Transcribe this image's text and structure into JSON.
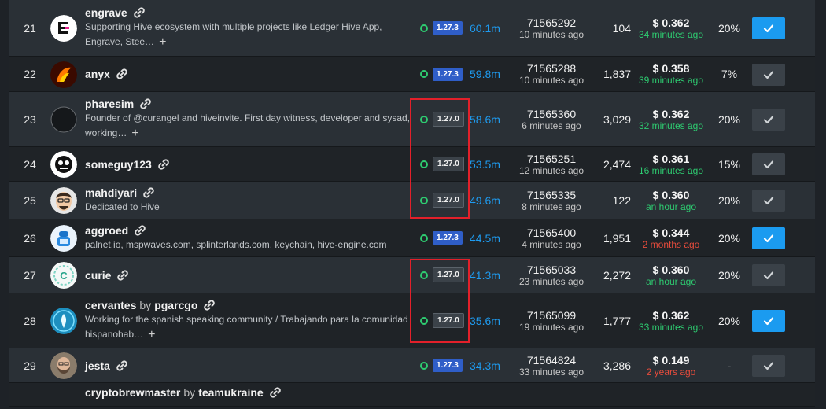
{
  "rows": [
    {
      "rank": "21",
      "name": "engrave",
      "by": "",
      "proxy": "",
      "desc": "Supporting Hive ecosystem with multiple projects like Ledger Hive App, Engrave, Stee…",
      "more": true,
      "version": "1.27.3",
      "vstatus": "new",
      "votes": "60.1m",
      "block": "71565292",
      "block_time": "10 minutes ago",
      "missed": "104",
      "price": "$ 0.362",
      "price_time": "34 minutes ago",
      "price_status": "green",
      "apr": "20%",
      "voted": true,
      "avatar": "engrave"
    },
    {
      "rank": "22",
      "name": "anyx",
      "by": "",
      "proxy": "",
      "desc": "",
      "more": false,
      "version": "1.27.3",
      "vstatus": "new",
      "votes": "59.8m",
      "block": "71565288",
      "block_time": "10 minutes ago",
      "missed": "1,837",
      "price": "$ 0.358",
      "price_time": "39 minutes ago",
      "price_status": "green",
      "apr": "7%",
      "voted": false,
      "avatar": "anyx"
    },
    {
      "rank": "23",
      "name": "pharesim",
      "by": "",
      "proxy": "",
      "desc": "Founder of @curangel and hiveinvite. First day witness, developer and sysad, working…",
      "more": true,
      "version": "1.27.0",
      "vstatus": "old",
      "votes": "58.6m",
      "block": "71565360",
      "block_time": "6 minutes ago",
      "missed": "3,029",
      "price": "$ 0.362",
      "price_time": "32 minutes ago",
      "price_status": "green",
      "apr": "20%",
      "voted": false,
      "avatar": "pharesim"
    },
    {
      "rank": "24",
      "name": "someguy123",
      "by": "",
      "proxy": "",
      "desc": "",
      "more": false,
      "version": "1.27.0",
      "vstatus": "old",
      "votes": "53.5m",
      "block": "71565251",
      "block_time": "12 minutes ago",
      "missed": "2,474",
      "price": "$ 0.361",
      "price_time": "16 minutes ago",
      "price_status": "green",
      "apr": "15%",
      "voted": false,
      "avatar": "someguy"
    },
    {
      "rank": "25",
      "name": "mahdiyari",
      "by": "",
      "proxy": "",
      "desc": "Dedicated to Hive",
      "more": false,
      "version": "1.27.0",
      "vstatus": "old",
      "votes": "49.6m",
      "block": "71565335",
      "block_time": "8 minutes ago",
      "missed": "122",
      "price": "$ 0.360",
      "price_time": "an hour ago",
      "price_status": "green",
      "apr": "20%",
      "voted": false,
      "avatar": "mahdiyari"
    },
    {
      "rank": "26",
      "name": "aggroed",
      "by": "",
      "proxy": "",
      "desc": "palnet.io, mspwaves.com, splinterlands.com, keychain, hive-engine.com",
      "more": false,
      "version": "1.27.3",
      "vstatus": "new",
      "votes": "44.5m",
      "block": "71565400",
      "block_time": "4 minutes ago",
      "missed": "1,951",
      "price": "$ 0.344",
      "price_time": "2 months ago",
      "price_status": "red",
      "apr": "20%",
      "voted": true,
      "avatar": "aggroed"
    },
    {
      "rank": "27",
      "name": "curie",
      "by": "",
      "proxy": "",
      "desc": "",
      "more": false,
      "version": "1.27.0",
      "vstatus": "old",
      "votes": "41.3m",
      "block": "71565033",
      "block_time": "23 minutes ago",
      "missed": "2,272",
      "price": "$ 0.360",
      "price_time": "an hour ago",
      "price_status": "green",
      "apr": "20%",
      "voted": false,
      "avatar": "curie"
    },
    {
      "rank": "28",
      "name": "cervantes",
      "by": "by",
      "proxy": "pgarcgo",
      "desc": "Working for the spanish speaking community / Trabajando para la comunidad hispanohab…",
      "more": true,
      "version": "1.27.0",
      "vstatus": "old",
      "votes": "35.6m",
      "block": "71565099",
      "block_time": "19 minutes ago",
      "missed": "1,777",
      "price": "$ 0.362",
      "price_time": "33 minutes ago",
      "price_status": "green",
      "apr": "20%",
      "voted": true,
      "avatar": "cervantes"
    },
    {
      "rank": "29",
      "name": "jesta",
      "by": "",
      "proxy": "",
      "desc": "",
      "more": false,
      "version": "1.27.3",
      "vstatus": "new",
      "votes": "34.3m",
      "block": "71564824",
      "block_time": "33 minutes ago",
      "missed": "3,286",
      "price": "$ 0.149",
      "price_time": "2 years ago",
      "price_status": "red",
      "apr": "-",
      "voted": false,
      "avatar": "jesta"
    },
    {
      "rank": "",
      "name": "cryptobrewmaster",
      "by": "by",
      "proxy": "teamukraine",
      "desc": "",
      "more": false,
      "version": "",
      "vstatus": "",
      "votes": "",
      "block": "",
      "block_time": "",
      "missed": "",
      "price": "",
      "price_time": "",
      "price_status": "",
      "apr": "",
      "voted": false,
      "avatar": "none"
    }
  ],
  "colors": {
    "accent": "#1b9bf0",
    "badge_new": "#2f5ec8",
    "highlight": "#e3202a",
    "online": "#2ecc71"
  }
}
